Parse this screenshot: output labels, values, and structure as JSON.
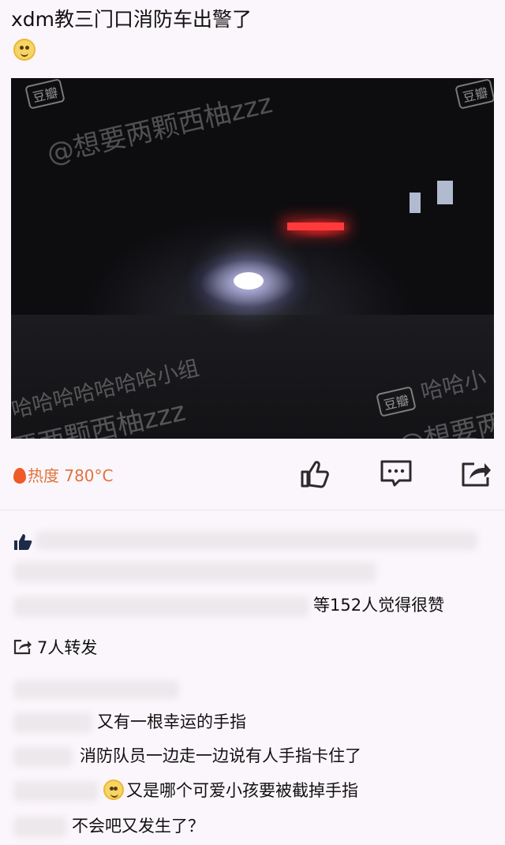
{
  "post": {
    "title": "xdm教三门口消防车出警了"
  },
  "photo": {
    "watermark_1": "@想要两颗西柚zzz",
    "watermark_2": "哈哈哈哈哈哈哈小组",
    "watermark_3": "要两颗西柚zzz",
    "watermark_4": "哈哈小",
    "watermark_5": "@想要两",
    "badge": "豆瓣"
  },
  "stats": {
    "heat": "热度 780°C",
    "likes": "等152人觉得很赞",
    "reshares": "7人转发"
  },
  "comments": [
    {
      "text": "又有一根幸运的手指"
    },
    {
      "text": "消防队员一边走一边说有人手指卡住了"
    },
    {
      "text": "又是哪个可爱小孩要被截掉手指"
    },
    {
      "text": "不会吧又发生了？"
    }
  ]
}
